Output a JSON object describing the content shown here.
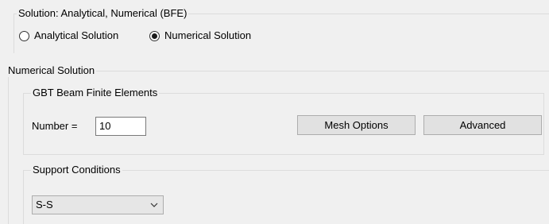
{
  "solution_group": {
    "title": "Solution: Analytical, Numerical (BFE)",
    "options": [
      {
        "label": "Analytical Solution",
        "selected": false
      },
      {
        "label": "Numerical Solution",
        "selected": true
      }
    ]
  },
  "numerical_group": {
    "title": "Numerical Solution",
    "gbt_group": {
      "title": "GBT Beam Finite Elements",
      "number_label": "Number =",
      "number_value": "10",
      "mesh_options_label": "Mesh Options",
      "advanced_label": "Advanced"
    },
    "support_group": {
      "title": "Support Conditions",
      "selected_value": "S-S"
    }
  },
  "icons": {
    "dropdown": "chevron-down-icon",
    "radio_checked": "radio-checked-icon",
    "radio_unchecked": "radio-unchecked-icon"
  }
}
